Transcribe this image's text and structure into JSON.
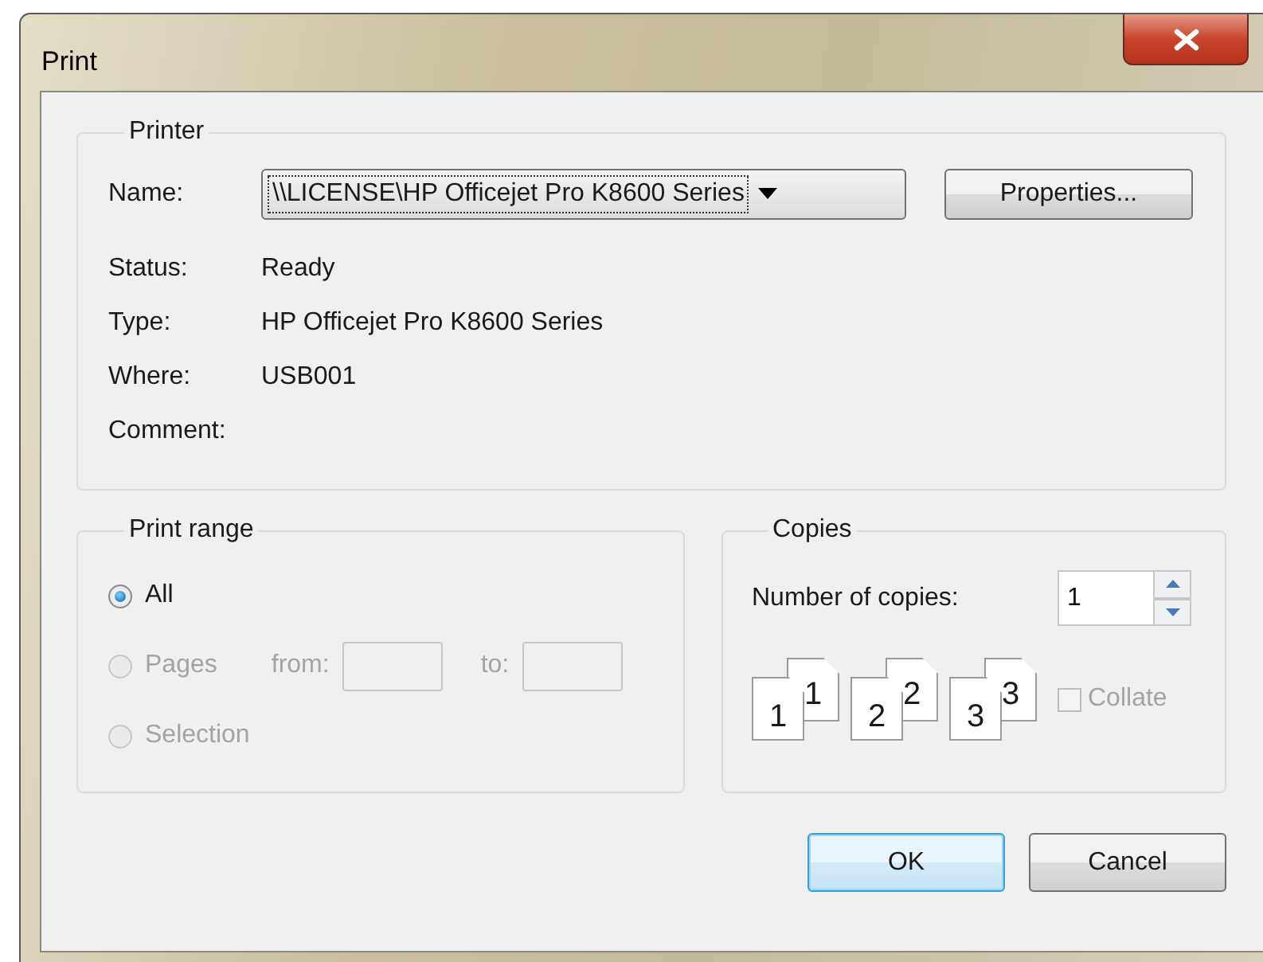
{
  "window": {
    "title": "Print"
  },
  "printer": {
    "group_title": "Printer",
    "name_label": "Name:",
    "name_value": "\\\\LICENSE\\HP Officejet Pro K8600 Series",
    "properties_button": "Properties...",
    "details": [
      {
        "label": "Status:",
        "value": "Ready"
      },
      {
        "label": "Type:",
        "value": "HP Officejet Pro K8600 Series"
      },
      {
        "label": "Where:",
        "value": "USB001"
      },
      {
        "label": "Comment:"
      }
    ]
  },
  "print_range": {
    "group_title": "Print range",
    "options": [
      {
        "label": "All",
        "selected": true,
        "disabled": false
      },
      {
        "label": "Pages",
        "selected": false,
        "disabled": true,
        "from_label": "from:",
        "to_label": "to:"
      },
      {
        "label": "Selection",
        "selected": false,
        "disabled": true
      }
    ]
  },
  "copies": {
    "group_title": "Copies",
    "count_label": "Number of copies:",
    "count_value": "1",
    "collate_pages": [
      [
        "1",
        "1"
      ],
      [
        "2",
        "2"
      ],
      [
        "3",
        "3"
      ]
    ],
    "collate": {
      "label": "Collate",
      "checked": false,
      "disabled": true
    }
  },
  "buttons": [
    {
      "label": "OK",
      "default": true
    },
    {
      "label": "Cancel",
      "default": false
    }
  ]
}
